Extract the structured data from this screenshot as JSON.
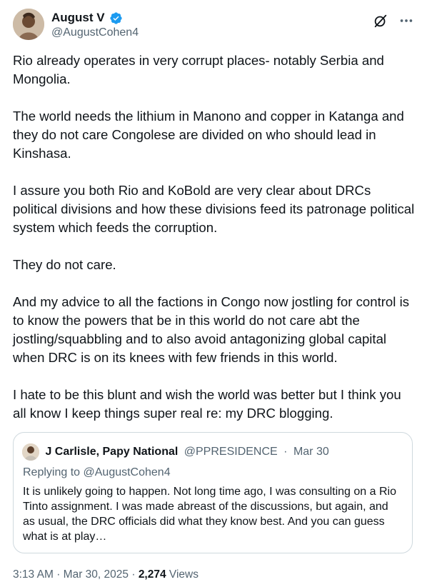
{
  "author": {
    "display_name": "August V",
    "handle": "@AugustCohen4",
    "verified": true,
    "verified_color": "#1d9bf0"
  },
  "header_actions": {
    "grok_icon": "grok-icon",
    "more_icon": "more-dots-icon"
  },
  "tweet": {
    "paragraphs": [
      "Rio already operates in very corrupt places- notably Serbia and Mongolia.",
      "The world needs the lithium in Manono and copper in Katanga and they do not care Congolese are divided on who should lead in Kinshasa.",
      "I assure you both Rio and KoBold are very clear about DRCs political divisions and how these divisions feed its patronage political system which feeds the corruption.",
      "They do not care.",
      "And my advice to all the factions in Congo now jostling for control is to know the powers that be in this world do not care abt the jostling/squabbling and to also avoid antagonizing global capital when DRC is on its knees with few friends in this world.",
      "I hate to be this blunt and wish the world was better but I think you all know I keep things super real re: my DRC blogging."
    ]
  },
  "quote": {
    "display_name": "J Carlisle, Papy National",
    "handle": "@PPRESIDENCE",
    "separator": "·",
    "date": "Mar 30",
    "replying_label": "Replying to",
    "replying_to": "@AugustCohen4",
    "text": "It is unlikely going to happen. Not long time ago, I was consulting on a Rio Tinto assignment. I was made abreast of the discussions, but again, and as usual, the DRC officials did what they know best. And you can guess what is at play…"
  },
  "meta": {
    "time": "3:13 AM",
    "separator": "·",
    "date": "Mar 30, 2025",
    "views_count": "2,274",
    "views_label": "Views"
  }
}
